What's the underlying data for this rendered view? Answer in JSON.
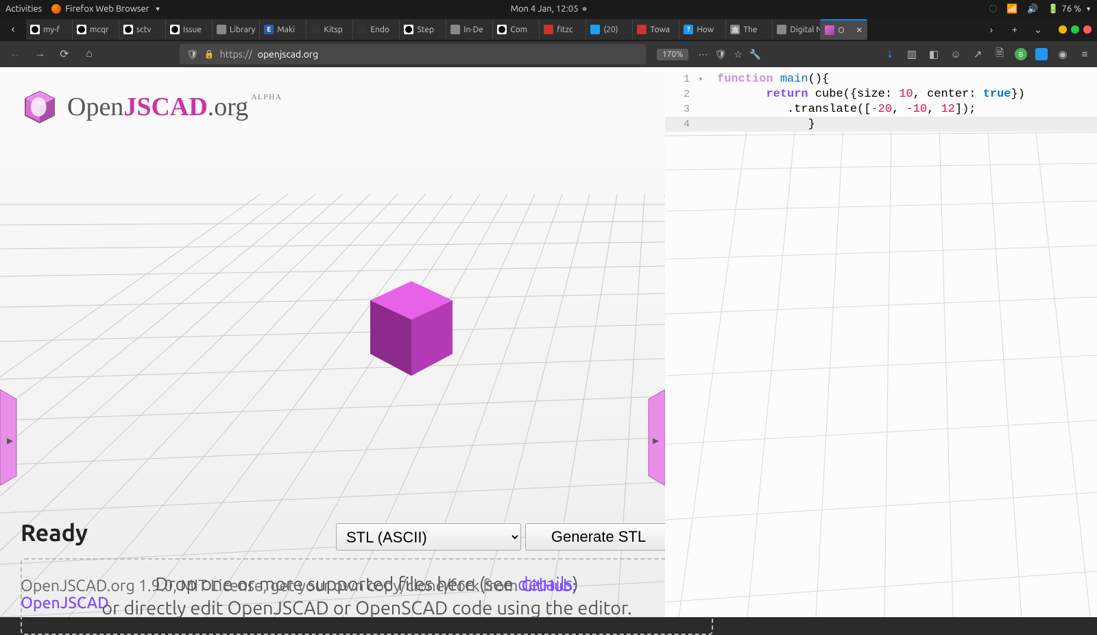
{
  "gnome": {
    "activities": "Activities",
    "app": "Firefox Web Browser",
    "clock": "Mon  4 Jan, 12:05",
    "battery": "76 %"
  },
  "tabs": [
    {
      "label": "my-f",
      "icon": "gh"
    },
    {
      "label": "mcqr",
      "icon": "gh"
    },
    {
      "label": "sctv",
      "icon": "gh"
    },
    {
      "label": "Issue",
      "icon": "gh"
    },
    {
      "label": "Library",
      "icon": "generic"
    },
    {
      "label": "Maki",
      "icon": "e"
    },
    {
      "label": "Kitsp",
      "icon": "cog"
    },
    {
      "label": "Endo",
      "icon": "cog"
    },
    {
      "label": "Step",
      "icon": "gh"
    },
    {
      "label": "In-De",
      "icon": "generic"
    },
    {
      "label": "Com",
      "icon": "gh"
    },
    {
      "label": "fitzc",
      "icon": "red"
    },
    {
      "label": "(20)",
      "icon": "tw"
    },
    {
      "label": "Towa",
      "icon": "red"
    },
    {
      "label": "How",
      "icon": "q"
    },
    {
      "label": "The",
      "icon": "bank"
    },
    {
      "label": "Digital N",
      "icon": "generic"
    },
    {
      "label": "O",
      "icon": "ojs",
      "active": true
    }
  ],
  "url": {
    "scheme": "https://",
    "domain": "openjscad.org",
    "zoom": "170%"
  },
  "logo": {
    "pre": "Open",
    "mid": "JSCAD",
    "suf": ".org",
    "badge": "ALPHA"
  },
  "code": {
    "lines": [
      {
        "n": "1",
        "fold": true
      },
      {
        "n": "2"
      },
      {
        "n": "3"
      },
      {
        "n": "4",
        "active": true
      }
    ],
    "l1a": "function",
    "l1b": " main",
    "l1c": "(){",
    "l2a": "return",
    "l2b": " cube({size: ",
    "l2c": "10",
    "l2d": ", center: ",
    "l2e": "true",
    "l2f": "})",
    "l3a": ".translate([",
    "l3b": "-20",
    "l3c": ", ",
    "l3d": "-10",
    "l3e": ", ",
    "l3f": "12",
    "l3g": "]);",
    "l4": "}"
  },
  "status": "Ready",
  "format": "STL (ASCII)",
  "generate": "Generate STL",
  "drop1a": "Drop one or more supported files here (see ",
  "drop1b": "details",
  "drop1c": ")",
  "drop2": "or directly edit OpenJSCAD or OpenSCAD code using the editor.",
  "footer_a": "OpenJSCAD.org 1.9.0, MIT License, get your own copy/clone/fork from ",
  "footer_b": "GitHub: OpenJSCAD"
}
